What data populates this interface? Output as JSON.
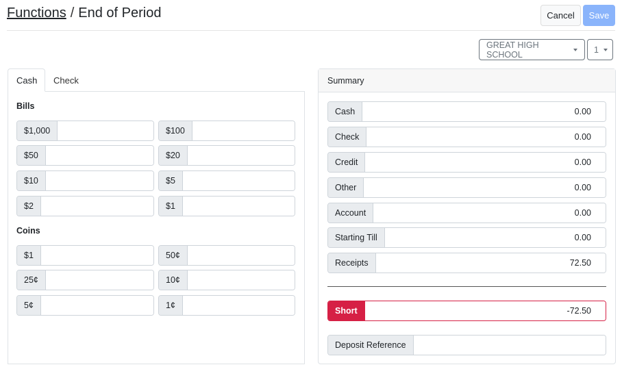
{
  "header": {
    "breadcrumb_link": "Functions",
    "separator": "/",
    "page_title": "End of Period"
  },
  "actions": {
    "cancel_label": "Cancel",
    "save_label": "Save"
  },
  "filters": {
    "school": "GREAT HIGH SCHOOL",
    "period": "1"
  },
  "tabs": [
    {
      "label": "Cash"
    },
    {
      "label": "Check"
    }
  ],
  "bills": {
    "title": "Bills",
    "items": [
      {
        "label": "$1,000",
        "value": ""
      },
      {
        "label": "$100",
        "value": ""
      },
      {
        "label": "$50",
        "value": ""
      },
      {
        "label": "$20",
        "value": ""
      },
      {
        "label": "$10",
        "value": ""
      },
      {
        "label": "$5",
        "value": ""
      },
      {
        "label": "$2",
        "value": ""
      },
      {
        "label": "$1",
        "value": ""
      }
    ]
  },
  "coins": {
    "title": "Coins",
    "items": [
      {
        "label": "$1",
        "value": ""
      },
      {
        "label": "50¢",
        "value": ""
      },
      {
        "label": "25¢",
        "value": ""
      },
      {
        "label": "10¢",
        "value": ""
      },
      {
        "label": "5¢",
        "value": ""
      },
      {
        "label": "1¢",
        "value": ""
      }
    ]
  },
  "summary": {
    "title": "Summary",
    "rows": [
      {
        "label": "Cash",
        "value": "0.00"
      },
      {
        "label": "Check",
        "value": "0.00"
      },
      {
        "label": "Credit",
        "value": "0.00"
      },
      {
        "label": "Other",
        "value": "0.00"
      },
      {
        "label": "Account",
        "value": "0.00"
      },
      {
        "label": "Starting Till",
        "value": "0.00"
      },
      {
        "label": "Receipts",
        "value": "72.50"
      }
    ],
    "short": {
      "label": "Short",
      "value": "-72.50"
    },
    "deposit_reference": {
      "label": "Deposit Reference",
      "value": ""
    },
    "colors": {
      "short": "#d62045",
      "save": "#8ab4fb"
    }
  }
}
